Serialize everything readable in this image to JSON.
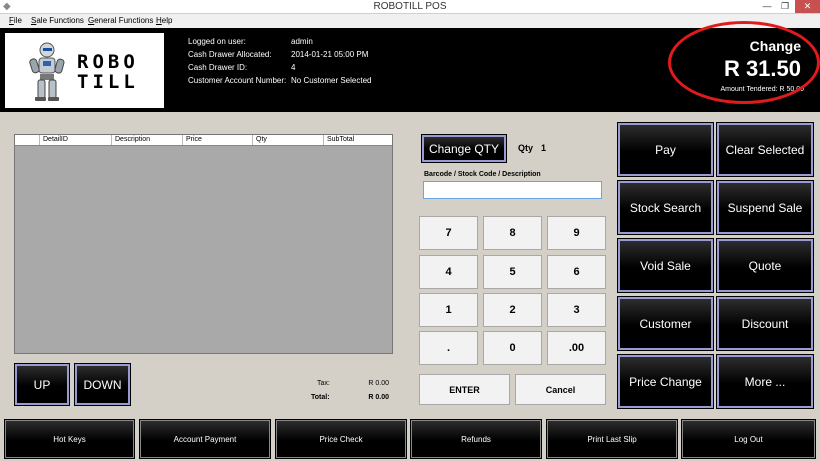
{
  "window": {
    "title": "ROBOTILL POS",
    "minimize": "—",
    "maximize": "❐",
    "close": "✕"
  },
  "menu": [
    "File",
    "Sale Functions",
    "General Functions",
    "Help"
  ],
  "logo": {
    "line1": "ROBO",
    "line2": "TILL"
  },
  "session": {
    "labels": [
      "Logged on user:",
      "Cash Drawer Allocated:",
      "Cash Drawer ID:",
      "Customer Account Number:"
    ],
    "values": [
      "admin",
      "2014-01-21 05:00 PM",
      "4",
      "No Customer Selected"
    ]
  },
  "change": {
    "label": "Change",
    "value": "R 31.50",
    "tendered": "Amount Tendered: R 50.00"
  },
  "grid": {
    "columns": [
      "DetailID",
      "Description",
      "Price",
      "Qty",
      "SubTotal"
    ]
  },
  "scroll": {
    "up": "UP",
    "down": "DOWN"
  },
  "totals": {
    "tax_label": "Tax:",
    "tax_value": "R 0.00",
    "total_label": "Total:",
    "total_value": "R 0.00"
  },
  "qty": {
    "button": "Change QTY",
    "label": "Qty",
    "value": "1"
  },
  "barcode": {
    "label": "Barcode / Stock Code / Description",
    "value": ""
  },
  "keypad": [
    "7",
    "8",
    "9",
    "4",
    "5",
    "6",
    "1",
    "2",
    "3",
    ".",
    "0",
    ".00"
  ],
  "keypad_actions": {
    "enter": "ENTER",
    "cancel": "Cancel"
  },
  "actions": [
    "Pay",
    "Clear Selected",
    "Stock Search",
    "Suspend Sale",
    "Void Sale",
    "Quote",
    "Customer",
    "Discount",
    "Price Change",
    "More ..."
  ],
  "bottom": [
    "Hot Keys",
    "Account Payment",
    "Price Check",
    "Refunds",
    "Print Last Slip",
    "Log Out"
  ]
}
